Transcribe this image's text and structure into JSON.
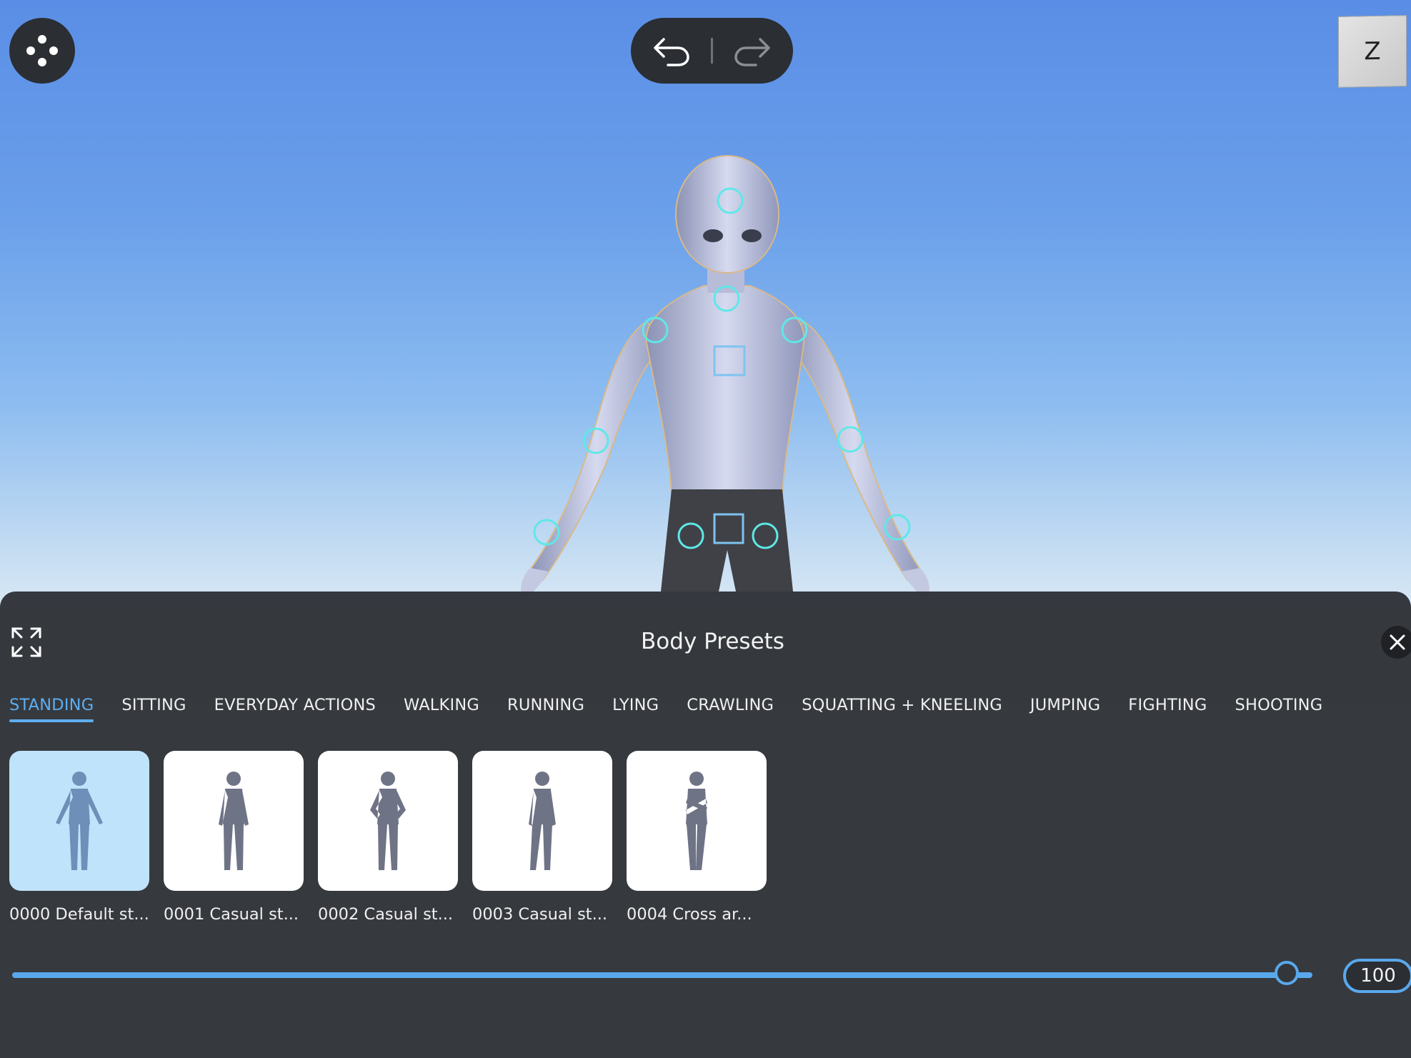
{
  "toolbar": {
    "menu_icon": "move-dots-icon",
    "undo_icon": "undo-arrow-icon",
    "redo_icon": "redo-arrow-icon"
  },
  "view_cube": {
    "axis_label": "Z"
  },
  "panel": {
    "title": "Body Presets",
    "expand_icon": "expand-arrows-icon",
    "close_icon": "close-icon",
    "tabs": [
      {
        "label": "STANDING",
        "active": true
      },
      {
        "label": "SITTING",
        "active": false
      },
      {
        "label": "EVERYDAY ACTIONS",
        "active": false
      },
      {
        "label": "WALKING",
        "active": false
      },
      {
        "label": "RUNNING",
        "active": false
      },
      {
        "label": "LYING",
        "active": false
      },
      {
        "label": "CRAWLING",
        "active": false
      },
      {
        "label": "SQUATTING + KNEELING",
        "active": false
      },
      {
        "label": "JUMPING",
        "active": false
      },
      {
        "label": "FIGHTING",
        "active": false
      },
      {
        "label": "SHOOTING",
        "active": false
      }
    ],
    "presets": [
      {
        "label": "0000 Default st...",
        "selected": true
      },
      {
        "label": "0001 Casual st...",
        "selected": false
      },
      {
        "label": "0002 Casual st...",
        "selected": false
      },
      {
        "label": "0003 Casual st...",
        "selected": false
      },
      {
        "label": "0004 Cross ar...",
        "selected": false
      }
    ],
    "slider": {
      "value": "100",
      "fraction": 0.98
    }
  },
  "colors": {
    "accent": "#59a8ec",
    "panel_bg": "#2e3136",
    "sky_top": "#5a8ee6",
    "joint_marker": "#5ee8e8",
    "selected_thumb": "#bfe3fb"
  }
}
